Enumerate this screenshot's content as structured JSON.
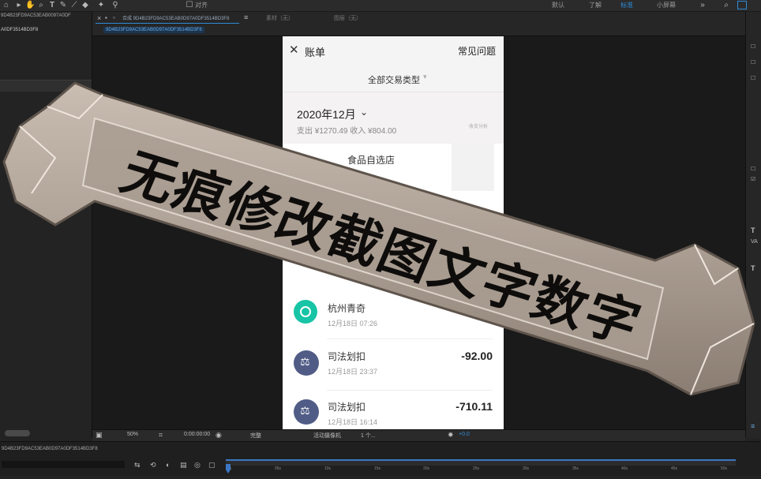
{
  "ae": {
    "toolbar": {
      "align_label": "对齐",
      "workspaces": [
        "默认",
        "了解",
        "标准",
        "小屏幕"
      ],
      "active_workspace": "标准"
    },
    "project": {
      "id_top": "9D4B23FD9AC53EAB0097A0DF",
      "id_second": "A0DF3514BD3F8"
    },
    "comp": {
      "tab_name": "合成 9D4B23FD9AC53EAB0D97A0DF3514BD3F8",
      "sub_tab": "9D4B23FD9AC53EAB0D97A0DF3514BD3F8",
      "footage_label": "素材（无）",
      "layer_label": "图层（无）"
    },
    "viewer_bar": {
      "zoom": "50%",
      "timecode": "0:00:00:00",
      "resolution": "完整",
      "camera": "活动摄像机",
      "views": "1 个...",
      "offset": "+0.0"
    },
    "timeline": {
      "comp_name": "9D4B23FD9AC53EAB0D97A0DF3514BD3F8",
      "ticks": [
        "0s",
        "05s",
        "10s",
        "15s",
        "20s",
        "25s",
        "30s",
        "35s",
        "40s",
        "45s",
        "50s"
      ]
    }
  },
  "phone": {
    "header": {
      "title": "账单",
      "help": "常见问题"
    },
    "filter": "全部交易类型",
    "month": {
      "label": "2020年12月",
      "summary": "支出 ¥1270.49 收入 ¥804.00",
      "side_label": "收支分析"
    },
    "partial_merchant": "食品自选店",
    "transactions": [
      {
        "name": "杭州青奇",
        "time": "12月18日 07:26",
        "amount": "",
        "icon": "green-ring-icon"
      },
      {
        "name": "司法划扣",
        "time": "12月18日 23:37",
        "amount": "-92.00",
        "icon": "gavel-icon"
      },
      {
        "name": "司法划扣",
        "time": "12月18日 16:14",
        "amount": "-710.11",
        "icon": "gavel-icon"
      }
    ]
  },
  "banner": {
    "text": "无痕修改截图文字数字",
    "colors": {
      "stone": "#b5a89b",
      "stone_dark": "#7a6e64",
      "text": "#0e0d0c"
    }
  }
}
